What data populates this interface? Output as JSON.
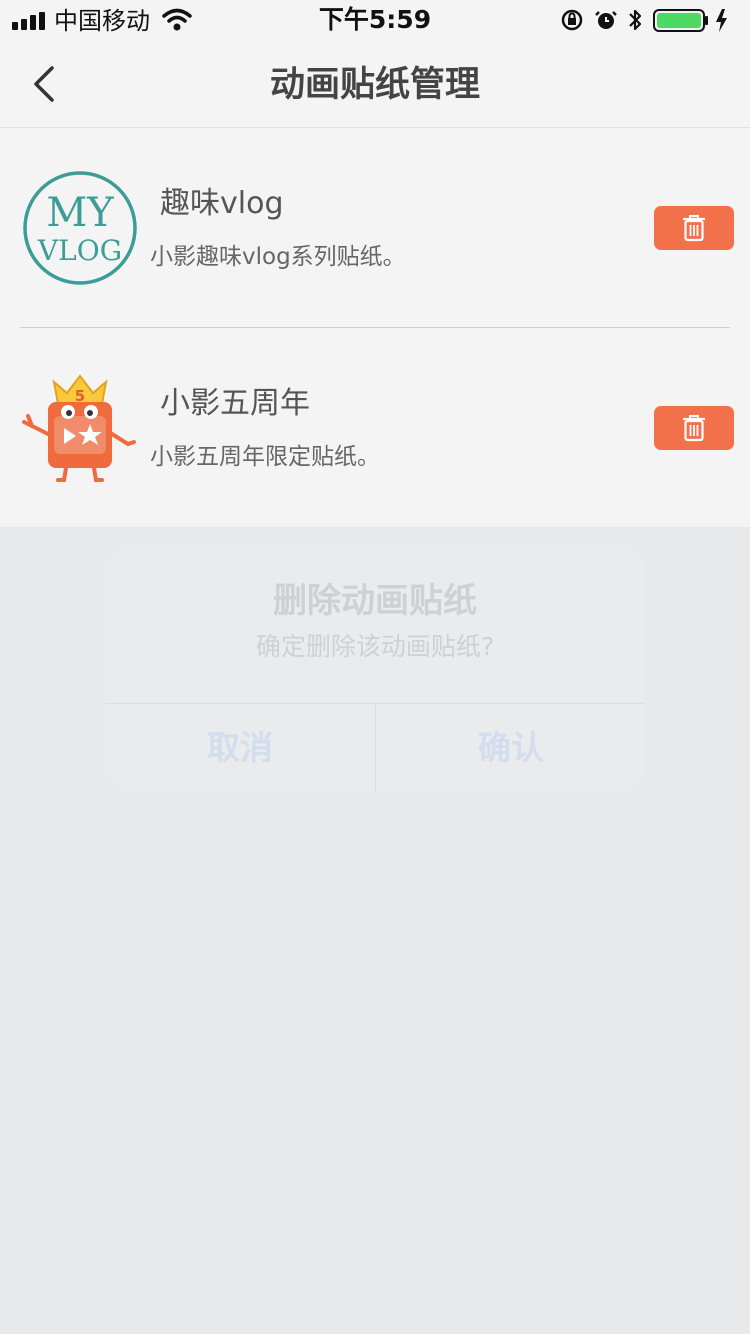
{
  "status_bar": {
    "carrier": "中国移动",
    "time": "下午5:59"
  },
  "nav": {
    "title": "动画贴纸管理"
  },
  "stickers": [
    {
      "name": "趣味vlog",
      "description": "小影趣味vlog系列贴纸。",
      "thumbnail": "my-vlog-badge",
      "thumbnail_text": [
        "MY",
        "VLOG"
      ]
    },
    {
      "name": "小影五周年",
      "description": "小影五周年限定贴纸。",
      "thumbnail": "anniversary-mascot",
      "thumbnail_text": [
        "5"
      ]
    }
  ],
  "dialog": {
    "title": "删除动画贴纸",
    "message": "确定删除该动画贴纸?",
    "cancel_label": "取消",
    "confirm_label": "确认"
  },
  "colors": {
    "delete_button": "#f2714a",
    "badge_teal": "#3c9c96",
    "battery_green": "#4cd964",
    "overlay": "#e8e9eb",
    "dialog_button_text": "#d3dded"
  }
}
